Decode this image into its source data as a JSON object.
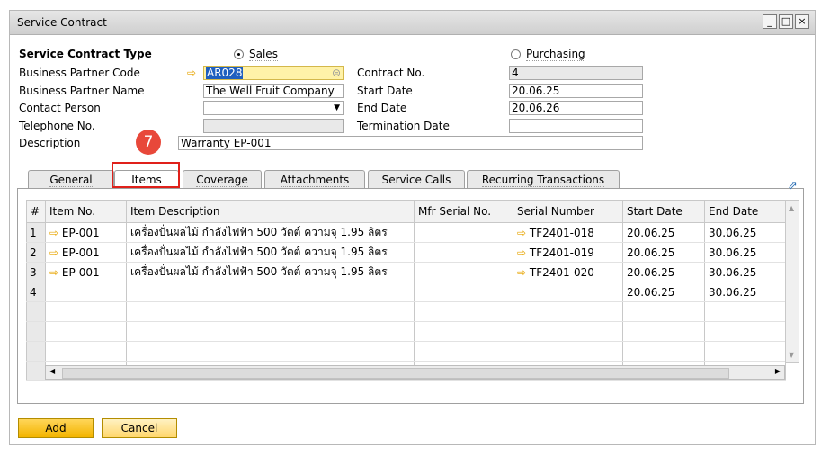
{
  "window": {
    "title": "Service Contract"
  },
  "header": {
    "contract_type_label": "Service Contract Type",
    "sales_label": "Sales",
    "purchasing_label": "Purchasing",
    "bp_code_label": "Business Partner Code",
    "bp_code_value": "AR028",
    "bp_name_label": "Business Partner Name",
    "bp_name_value": "The Well Fruit Company",
    "contact_person_label": "Contact Person",
    "contact_person_value": "",
    "telephone_label": "Telephone No.",
    "description_label": "Description",
    "description_value": "Warranty EP-001",
    "contract_no_label": "Contract No.",
    "contract_no_value": "4",
    "start_date_label": "Start Date",
    "start_date_value": "20.06.25",
    "end_date_label": "End Date",
    "end_date_value": "20.06.26",
    "termination_date_label": "Termination Date",
    "termination_date_value": ""
  },
  "step_badge": "7",
  "tabs": [
    "General",
    "Items",
    "Coverage",
    "Attachments",
    "Service Calls",
    "Recurring Transactions"
  ],
  "grid": {
    "columns": [
      "#",
      "Item No.",
      "Item Description",
      "Mfr Serial No.",
      "Serial Number",
      "Start Date",
      "End Date"
    ],
    "rows": [
      {
        "num": "1",
        "item_no": "EP-001",
        "desc": "เครื่องปั่นผลไม้ กำลังไฟฟ้า 500 วัตต์ ความจุ 1.95 ลิตร",
        "mfr": "",
        "serial": "TF2401-018",
        "start": "20.06.25",
        "end": "30.06.25"
      },
      {
        "num": "2",
        "item_no": "EP-001",
        "desc": "เครื่องปั่นผลไม้ กำลังไฟฟ้า 500 วัตต์ ความจุ 1.95 ลิตร",
        "mfr": "",
        "serial": "TF2401-019",
        "start": "20.06.25",
        "end": "30.06.25"
      },
      {
        "num": "3",
        "item_no": "EP-001",
        "desc": "เครื่องปั่นผลไม้ กำลังไฟฟ้า 500 วัตต์ ความจุ 1.95 ลิตร",
        "mfr": "",
        "serial": "TF2401-020",
        "start": "20.06.25",
        "end": "30.06.25"
      },
      {
        "num": "4",
        "item_no": "",
        "desc": "",
        "mfr": "",
        "serial": "",
        "start": "20.06.25",
        "end": "30.06.25"
      }
    ]
  },
  "buttons": {
    "add": "Add",
    "cancel": "Cancel"
  },
  "icons": {
    "link_arrow": "arrow-right-icon",
    "expand": "expand-icon"
  },
  "colors": {
    "accent": "#f3b400",
    "highlight": "#e0201a"
  }
}
